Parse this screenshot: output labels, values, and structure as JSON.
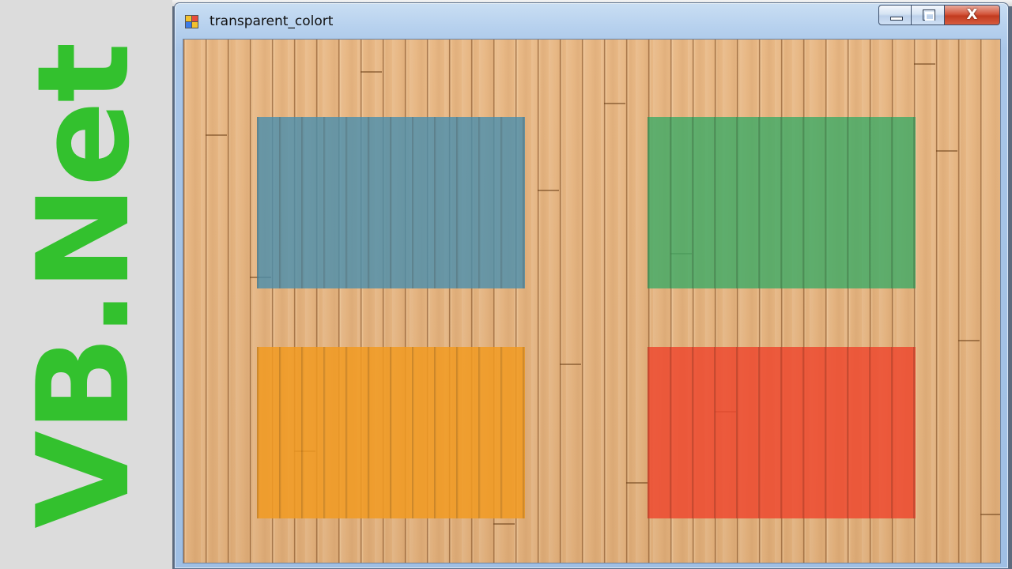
{
  "banner": {
    "text": "VB.Net",
    "color": "#33c12e"
  },
  "window": {
    "title": "transparent_colort",
    "icon": "winforms-app-icon",
    "controls": {
      "minimize_icon": "minimize-icon",
      "maximize_icon": "restore-icon",
      "close_label": "X"
    }
  },
  "client": {
    "background": "wood-floor-texture",
    "panels": [
      {
        "name": "blue-panel",
        "color": "#4a8fae",
        "opacity": 0.8
      },
      {
        "name": "green-panel",
        "color": "#3dab66",
        "opacity": 0.8
      },
      {
        "name": "orange-panel",
        "color": "#f29b22",
        "opacity": 0.85
      },
      {
        "name": "red-panel",
        "color": "#ee4a30",
        "opacity": 0.85
      }
    ]
  }
}
